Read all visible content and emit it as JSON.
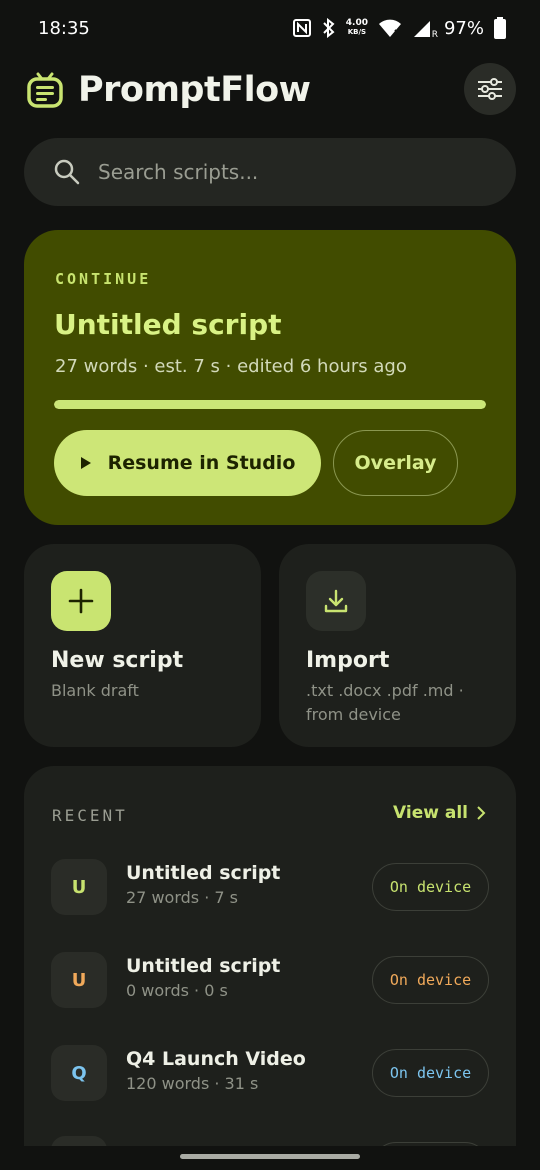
{
  "status_bar": {
    "time": "18:35",
    "net_speed_value": "4.00",
    "net_speed_unit": "KB/S",
    "signal_label": "R",
    "battery": "97%",
    "icons": [
      "nfc-icon",
      "bluetooth-icon",
      "wifi-icon",
      "signal-icon",
      "battery-icon"
    ]
  },
  "app": {
    "title": "PromptFlow",
    "logo_icon": "teleprompter-logo-icon",
    "settings_icon": "sliders-icon"
  },
  "search": {
    "placeholder": "Search scripts..."
  },
  "continue_card": {
    "kicker": "CONTINUE",
    "title": "Untitled script",
    "meta": "27 words · est. 7 s · edited 6 hours ago",
    "progress": 1.0,
    "resume_label": "Resume in Studio",
    "overlay_label": "Overlay"
  },
  "actions": {
    "new_script": {
      "title": "New script",
      "subtitle": "Blank draft",
      "icon": "plus-icon"
    },
    "import": {
      "title": "Import",
      "subtitle": ".txt .docx .pdf .md · from device",
      "icon": "download-icon"
    }
  },
  "recent": {
    "heading": "RECENT",
    "view_all": "View all",
    "items": [
      {
        "initial": "U",
        "title": "Untitled script",
        "meta": "27 words · 7 s",
        "badge": "On device",
        "color": "#c7e26f"
      },
      {
        "initial": "U",
        "title": "Untitled script",
        "meta": "0 words · 0 s",
        "badge": "On device",
        "color": "#f0a95a"
      },
      {
        "initial": "Q",
        "title": "Q4 Launch Video",
        "meta": "120 words · 31 s",
        "badge": "On device",
        "color": "#7cc4ee"
      }
    ]
  },
  "colors": {
    "background": "#111210",
    "accent": "#c9e471",
    "hero": "#414c00"
  }
}
